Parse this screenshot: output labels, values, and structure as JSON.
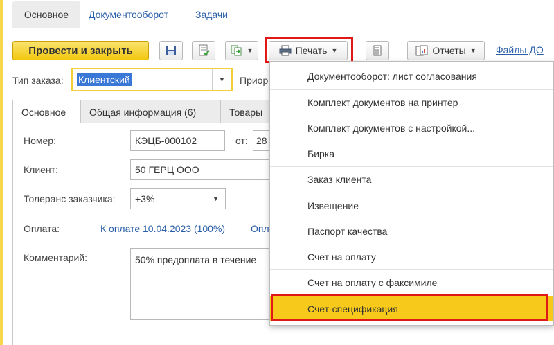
{
  "nav": {
    "tabs": [
      {
        "label": "Основное"
      },
      {
        "label": "Документооборот"
      },
      {
        "label": "Задачи"
      }
    ]
  },
  "toolbar": {
    "post_close_label": "Провести и закрыть",
    "print_label": "Печать",
    "reports_label": "Отчеты",
    "files_label": "Файлы ДО"
  },
  "order_type": {
    "label": "Тип заказа:",
    "value": "Клиентский",
    "priority_label": "Приор"
  },
  "inner_tabs": [
    {
      "label": "Основное"
    },
    {
      "label": "Общая информация (6)"
    },
    {
      "label": "Товары"
    }
  ],
  "form": {
    "number_label": "Номер:",
    "number_value": "КЭЦБ-000102",
    "from_label": "от:",
    "date_value": "28",
    "client_label": "Клиент:",
    "client_value": "50 ГЕРЦ ООО",
    "tolerance_label": "Толеранс заказчика:",
    "tolerance_value": "+3%",
    "payment_label": "Оплата:",
    "payment_link": "К оплате 10.04.2023 (100%)",
    "payment_link2": "Опл",
    "comment_label": "Комментарий:",
    "comment_value": "50% предоплата в течение"
  },
  "print_menu": {
    "items": [
      {
        "label": "Документооборот: лист согласования"
      },
      {
        "label": "Комплект документов на принтер"
      },
      {
        "label": "Комплект документов с настройкой..."
      },
      {
        "label": "Бирка"
      },
      {
        "label": "Заказ клиента"
      },
      {
        "label": "Извещение"
      },
      {
        "label": "Паспорт качества"
      },
      {
        "label": "Счет на оплату"
      },
      {
        "label": "Счет на оплату с факсимиле"
      },
      {
        "label": "Счет-спецификация"
      }
    ],
    "highlighted_item": "Счет-спецификация"
  },
  "colors": {
    "accent_yellow": "#f2c810",
    "highlight_red": "#e01818",
    "link_blue": "#2a5ea8",
    "selection_blue": "#3a78d8"
  }
}
